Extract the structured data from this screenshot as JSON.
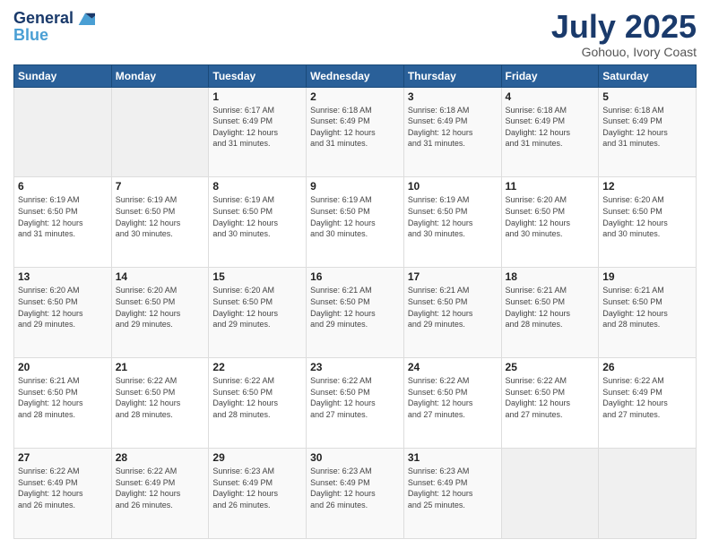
{
  "header": {
    "logo_line1": "General",
    "logo_line2": "Blue",
    "month": "July 2025",
    "location": "Gohouo, Ivory Coast"
  },
  "weekdays": [
    "Sunday",
    "Monday",
    "Tuesday",
    "Wednesday",
    "Thursday",
    "Friday",
    "Saturday"
  ],
  "weeks": [
    [
      {
        "day": "",
        "info": ""
      },
      {
        "day": "",
        "info": ""
      },
      {
        "day": "1",
        "info": "Sunrise: 6:17 AM\nSunset: 6:49 PM\nDaylight: 12 hours\nand 31 minutes."
      },
      {
        "day": "2",
        "info": "Sunrise: 6:18 AM\nSunset: 6:49 PM\nDaylight: 12 hours\nand 31 minutes."
      },
      {
        "day": "3",
        "info": "Sunrise: 6:18 AM\nSunset: 6:49 PM\nDaylight: 12 hours\nand 31 minutes."
      },
      {
        "day": "4",
        "info": "Sunrise: 6:18 AM\nSunset: 6:49 PM\nDaylight: 12 hours\nand 31 minutes."
      },
      {
        "day": "5",
        "info": "Sunrise: 6:18 AM\nSunset: 6:49 PM\nDaylight: 12 hours\nand 31 minutes."
      }
    ],
    [
      {
        "day": "6",
        "info": "Sunrise: 6:19 AM\nSunset: 6:50 PM\nDaylight: 12 hours\nand 31 minutes."
      },
      {
        "day": "7",
        "info": "Sunrise: 6:19 AM\nSunset: 6:50 PM\nDaylight: 12 hours\nand 30 minutes."
      },
      {
        "day": "8",
        "info": "Sunrise: 6:19 AM\nSunset: 6:50 PM\nDaylight: 12 hours\nand 30 minutes."
      },
      {
        "day": "9",
        "info": "Sunrise: 6:19 AM\nSunset: 6:50 PM\nDaylight: 12 hours\nand 30 minutes."
      },
      {
        "day": "10",
        "info": "Sunrise: 6:19 AM\nSunset: 6:50 PM\nDaylight: 12 hours\nand 30 minutes."
      },
      {
        "day": "11",
        "info": "Sunrise: 6:20 AM\nSunset: 6:50 PM\nDaylight: 12 hours\nand 30 minutes."
      },
      {
        "day": "12",
        "info": "Sunrise: 6:20 AM\nSunset: 6:50 PM\nDaylight: 12 hours\nand 30 minutes."
      }
    ],
    [
      {
        "day": "13",
        "info": "Sunrise: 6:20 AM\nSunset: 6:50 PM\nDaylight: 12 hours\nand 29 minutes."
      },
      {
        "day": "14",
        "info": "Sunrise: 6:20 AM\nSunset: 6:50 PM\nDaylight: 12 hours\nand 29 minutes."
      },
      {
        "day": "15",
        "info": "Sunrise: 6:20 AM\nSunset: 6:50 PM\nDaylight: 12 hours\nand 29 minutes."
      },
      {
        "day": "16",
        "info": "Sunrise: 6:21 AM\nSunset: 6:50 PM\nDaylight: 12 hours\nand 29 minutes."
      },
      {
        "day": "17",
        "info": "Sunrise: 6:21 AM\nSunset: 6:50 PM\nDaylight: 12 hours\nand 29 minutes."
      },
      {
        "day": "18",
        "info": "Sunrise: 6:21 AM\nSunset: 6:50 PM\nDaylight: 12 hours\nand 28 minutes."
      },
      {
        "day": "19",
        "info": "Sunrise: 6:21 AM\nSunset: 6:50 PM\nDaylight: 12 hours\nand 28 minutes."
      }
    ],
    [
      {
        "day": "20",
        "info": "Sunrise: 6:21 AM\nSunset: 6:50 PM\nDaylight: 12 hours\nand 28 minutes."
      },
      {
        "day": "21",
        "info": "Sunrise: 6:22 AM\nSunset: 6:50 PM\nDaylight: 12 hours\nand 28 minutes."
      },
      {
        "day": "22",
        "info": "Sunrise: 6:22 AM\nSunset: 6:50 PM\nDaylight: 12 hours\nand 28 minutes."
      },
      {
        "day": "23",
        "info": "Sunrise: 6:22 AM\nSunset: 6:50 PM\nDaylight: 12 hours\nand 27 minutes."
      },
      {
        "day": "24",
        "info": "Sunrise: 6:22 AM\nSunset: 6:50 PM\nDaylight: 12 hours\nand 27 minutes."
      },
      {
        "day": "25",
        "info": "Sunrise: 6:22 AM\nSunset: 6:50 PM\nDaylight: 12 hours\nand 27 minutes."
      },
      {
        "day": "26",
        "info": "Sunrise: 6:22 AM\nSunset: 6:49 PM\nDaylight: 12 hours\nand 27 minutes."
      }
    ],
    [
      {
        "day": "27",
        "info": "Sunrise: 6:22 AM\nSunset: 6:49 PM\nDaylight: 12 hours\nand 26 minutes."
      },
      {
        "day": "28",
        "info": "Sunrise: 6:22 AM\nSunset: 6:49 PM\nDaylight: 12 hours\nand 26 minutes."
      },
      {
        "day": "29",
        "info": "Sunrise: 6:23 AM\nSunset: 6:49 PM\nDaylight: 12 hours\nand 26 minutes."
      },
      {
        "day": "30",
        "info": "Sunrise: 6:23 AM\nSunset: 6:49 PM\nDaylight: 12 hours\nand 26 minutes."
      },
      {
        "day": "31",
        "info": "Sunrise: 6:23 AM\nSunset: 6:49 PM\nDaylight: 12 hours\nand 25 minutes."
      },
      {
        "day": "",
        "info": ""
      },
      {
        "day": "",
        "info": ""
      }
    ]
  ]
}
